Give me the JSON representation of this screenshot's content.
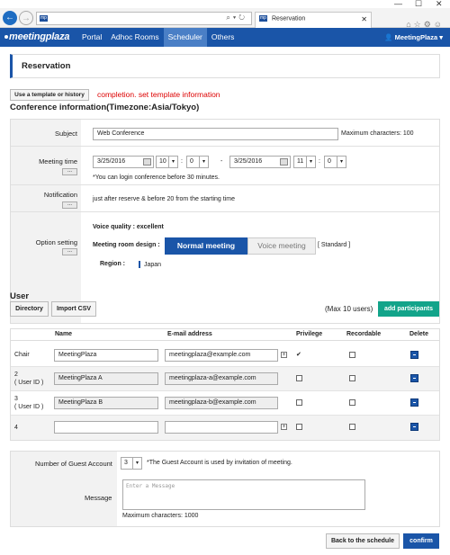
{
  "browser": {
    "min": "—",
    "max": "☐",
    "close": "✕",
    "address": "",
    "tab_title": "Reservation",
    "favicon": "mp"
  },
  "app": {
    "logo": "meetingplaza",
    "menu": [
      "Portal",
      "Adhoc Rooms",
      "Scheduler",
      "Others"
    ],
    "active_menu": "Scheduler",
    "user": "MeetingPlaza"
  },
  "page": {
    "title": "Reservation",
    "template_button": "Use a template or history",
    "template_msg": "completion. set template information",
    "conf_heading": "Conference information(Timezone:Asia/Tokyo)"
  },
  "conference": {
    "subject_label": "Subject",
    "subject_value": "Web Conference",
    "max_chars": "Maximum characters: 100",
    "meeting_time_label": "Meeting time",
    "start_date": "3/25/2016",
    "start_hour": "10",
    "start_min": "0",
    "dash": "-",
    "end_date": "3/25/2016",
    "end_hour": "11",
    "end_min": "0",
    "colon": ":",
    "login_note": "*You can login conference before 30 minutes.",
    "notification_label": "Notification",
    "notification_value": "just after reserve & before 20 from the starting time",
    "option_label": "Option setting",
    "voice_quality": "Voice quality : excellent",
    "design_label": "Meeting room design :",
    "normal_btn": "Normal meeting",
    "voice_btn": "Voice meeting",
    "standard": "[ Standard ]",
    "region_label": "Region :",
    "region_value": "Japan",
    "dots": "..."
  },
  "user": {
    "heading": "User",
    "directory": "Directory",
    "import_csv": "Import CSV",
    "max_users": "(Max 10 users)",
    "add_participants": "add participants",
    "columns": [
      "Name",
      "E-mail address",
      "Privilege",
      "Recordable",
      "Delete"
    ],
    "rows": [
      {
        "label": "Chair",
        "sub": "",
        "name": "MeetingPlaza",
        "email": "meetingplaza@example.com",
        "privilege": true
      },
      {
        "label": "2",
        "sub": "( User ID )",
        "name": "MeetingPlaza A",
        "email": "meetingplaza-a@example.com",
        "privilege": false
      },
      {
        "label": "3",
        "sub": "( User ID )",
        "name": "MeetingPlaza B",
        "email": "meetingplaza-b@example.com",
        "privilege": false
      },
      {
        "label": "4",
        "sub": "",
        "name": "",
        "email": "",
        "privilege": false
      }
    ],
    "check": "✔",
    "plus": "+"
  },
  "guest": {
    "count_label": "Number of Guest Account",
    "count_value": "3",
    "count_note": "*The Guest Account is used by invitation of meeting.",
    "message_label": "Message",
    "message_placeholder": "Enter a Message",
    "max_chars": "Maximum characters: 1000"
  },
  "footer": {
    "back": "Back to the schedule",
    "confirm": "confirm"
  }
}
